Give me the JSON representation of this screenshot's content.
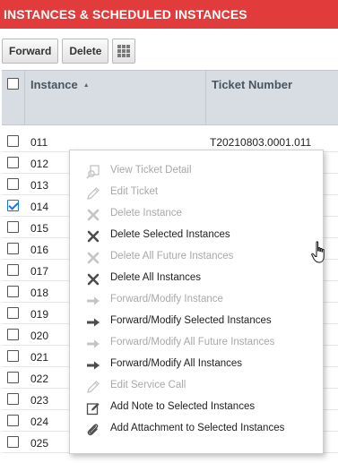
{
  "header": {
    "title": "INSTANCES & SCHEDULED INSTANCES"
  },
  "toolbar": {
    "forward_label": "Forward",
    "delete_label": "Delete",
    "grid_icon": "grid-columns-icon"
  },
  "grid": {
    "columns": {
      "instance": "Instance",
      "ticket_number": "Ticket Number"
    },
    "rows": [
      {
        "instance": "011",
        "ticket": "T20210803.0001.011",
        "checked": false
      },
      {
        "instance": "012",
        "ticket": "",
        "checked": false
      },
      {
        "instance": "013",
        "ticket": "",
        "checked": false
      },
      {
        "instance": "014",
        "ticket": "",
        "checked": true
      },
      {
        "instance": "015",
        "ticket": "",
        "checked": false
      },
      {
        "instance": "016",
        "ticket": "",
        "checked": false
      },
      {
        "instance": "017",
        "ticket": "",
        "checked": false
      },
      {
        "instance": "018",
        "ticket": "",
        "checked": false
      },
      {
        "instance": "019",
        "ticket": "",
        "checked": false
      },
      {
        "instance": "020",
        "ticket": "",
        "checked": false
      },
      {
        "instance": "021",
        "ticket": "",
        "checked": false
      },
      {
        "instance": "022",
        "ticket": "",
        "checked": false
      },
      {
        "instance": "023",
        "ticket": "",
        "checked": false
      },
      {
        "instance": "024",
        "ticket": "",
        "checked": false
      },
      {
        "instance": "025",
        "ticket": "",
        "checked": false
      }
    ]
  },
  "context_menu": {
    "items": [
      {
        "label": "View Ticket Detail",
        "icon": "view-ticket-icon",
        "enabled": false
      },
      {
        "label": "Edit Ticket",
        "icon": "pencil-icon",
        "enabled": false
      },
      {
        "label": "Delete Instance",
        "icon": "x-icon",
        "enabled": false
      },
      {
        "label": "Delete Selected Instances",
        "icon": "x-icon",
        "enabled": true
      },
      {
        "label": "Delete All Future Instances",
        "icon": "x-icon",
        "enabled": false
      },
      {
        "label": "Delete All Instances",
        "icon": "x-icon",
        "enabled": true
      },
      {
        "label": "Forward/Modify Instance",
        "icon": "forward-arrow-icon",
        "enabled": false
      },
      {
        "label": "Forward/Modify Selected Instances",
        "icon": "forward-arrow-icon",
        "enabled": true
      },
      {
        "label": "Forward/Modify All Future Instances",
        "icon": "forward-arrow-icon",
        "enabled": false
      },
      {
        "label": "Forward/Modify All Instances",
        "icon": "forward-arrow-icon",
        "enabled": true
      },
      {
        "label": "Edit Service Call",
        "icon": "pencil-icon",
        "enabled": false
      },
      {
        "label": "Add Note to Selected Instances",
        "icon": "note-icon",
        "enabled": true
      },
      {
        "label": "Add Attachment to Selected Instances",
        "icon": "paperclip-icon",
        "enabled": true
      }
    ]
  }
}
